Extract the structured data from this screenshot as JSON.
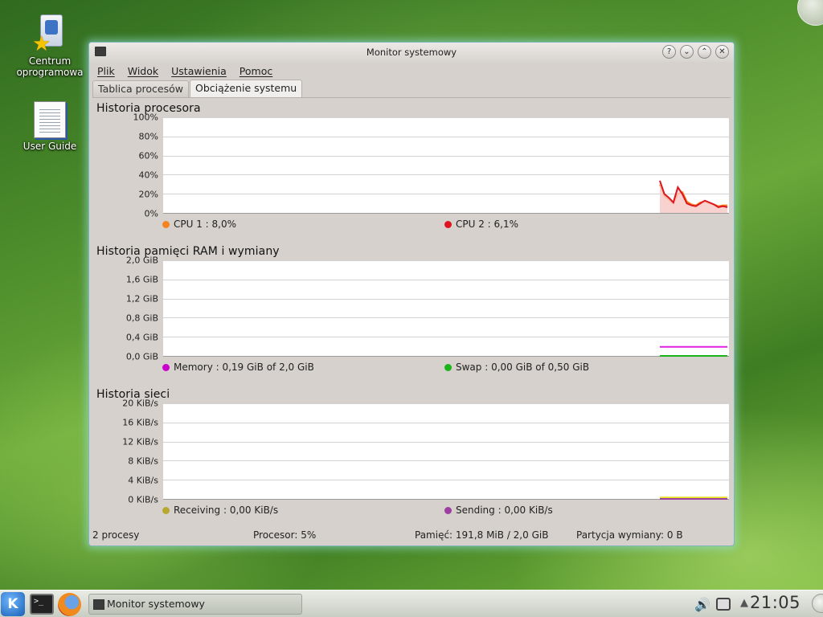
{
  "desktop": {
    "icons": [
      {
        "label": "Centrum oprogramowania",
        "display": "Centrum\noprogramowa"
      },
      {
        "label": "User Guide"
      }
    ]
  },
  "window": {
    "title": "Monitor systemowy",
    "buttons": {
      "help": "?",
      "min": "⌄",
      "max": "⌃",
      "close": "✕"
    },
    "menu": [
      "Plik",
      "Widok",
      "Ustawienia",
      "Pomoc"
    ],
    "tabs": [
      {
        "label": "Tablica procesów",
        "active": false
      },
      {
        "label": "Obciążenie systemu",
        "active": true
      }
    ],
    "status": {
      "processes": "2 procesy",
      "cpu": "Procesor: 5%",
      "memory": "Pamięć: 191,8 MiB / 2,0 GiB",
      "swap": "Partycja wymiany: 0 B"
    }
  },
  "chart_data": [
    {
      "type": "line",
      "title": "Historia procesora",
      "ylim": [
        0,
        100
      ],
      "yticks": [
        "100%",
        "80%",
        "60%",
        "40%",
        "20%",
        "0%"
      ],
      "grid": true,
      "legend": [
        {
          "text": "CPU 1 : 8,0%",
          "color": "#f58220"
        },
        {
          "text": "CPU 2 : 6,1%",
          "color": "#e0141e"
        }
      ],
      "series": [
        {
          "name": "CPU 1",
          "color": "#f58220",
          "fill": "#fbd7bf",
          "values": [
            30,
            18,
            14,
            10,
            20,
            22,
            12,
            9,
            8,
            11,
            12,
            10,
            9,
            7,
            8,
            8
          ]
        },
        {
          "name": "CPU 2",
          "color": "#e0141e",
          "fill": "#f7cccd",
          "values": [
            34,
            20,
            16,
            11,
            27,
            20,
            10,
            8,
            7,
            10,
            13,
            11,
            9,
            6,
            7,
            6
          ]
        }
      ]
    },
    {
      "type": "line",
      "title": "Historia pamięci RAM i wymiany",
      "ylim": [
        0,
        2.0
      ],
      "yticks": [
        "2,0 GiB",
        "1,6 GiB",
        "1,2 GiB",
        "0,8 GiB",
        "0,4 GiB",
        "0,0 GiB"
      ],
      "grid": true,
      "legend": [
        {
          "text": "Memory : 0,19 GiB of 2,0 GiB",
          "color": "#cc00cc"
        },
        {
          "text": "Swap : 0,00 GiB of 0,50 GiB",
          "color": "#1ab41a"
        }
      ],
      "series": [
        {
          "name": "Memory",
          "color": "#e020e0",
          "values": [
            0.19,
            0.19,
            0.19,
            0.19,
            0.19,
            0.19
          ]
        },
        {
          "name": "Swap",
          "color": "#1ab41a",
          "values": [
            0.0,
            0.0,
            0.0,
            0.0,
            0.0,
            0.0
          ]
        }
      ]
    },
    {
      "type": "line",
      "title": "Historia sieci",
      "ylim": [
        0,
        20
      ],
      "yticks": [
        "20 KiB/s",
        "16 KiB/s",
        "12 KiB/s",
        "8 KiB/s",
        "4 KiB/s",
        "0 KiB/s"
      ],
      "grid": true,
      "legend": [
        {
          "text": "Receiving : 0,00 KiB/s",
          "color": "#b8a830"
        },
        {
          "text": "Sending : 0,00 KiB/s",
          "color": "#9c3fa0"
        }
      ],
      "series": [
        {
          "name": "Receiving",
          "color": "#e8e020",
          "values": [
            0.3,
            0.3,
            0.3,
            0.3,
            0.3,
            0.3
          ]
        },
        {
          "name": "Sending",
          "color": "#9c3fa0",
          "values": [
            0.0,
            0.0,
            0.0,
            0.0,
            0.0,
            0.0
          ]
        }
      ]
    }
  ],
  "taskbar": {
    "task_label": "Monitor systemowy",
    "clock": "21:05",
    "tray_icons": [
      "volume-icon",
      "network-icon",
      "tray-arrow-icon"
    ],
    "launchers": [
      "kde-menu-icon",
      "terminal-icon",
      "firefox-icon"
    ]
  }
}
